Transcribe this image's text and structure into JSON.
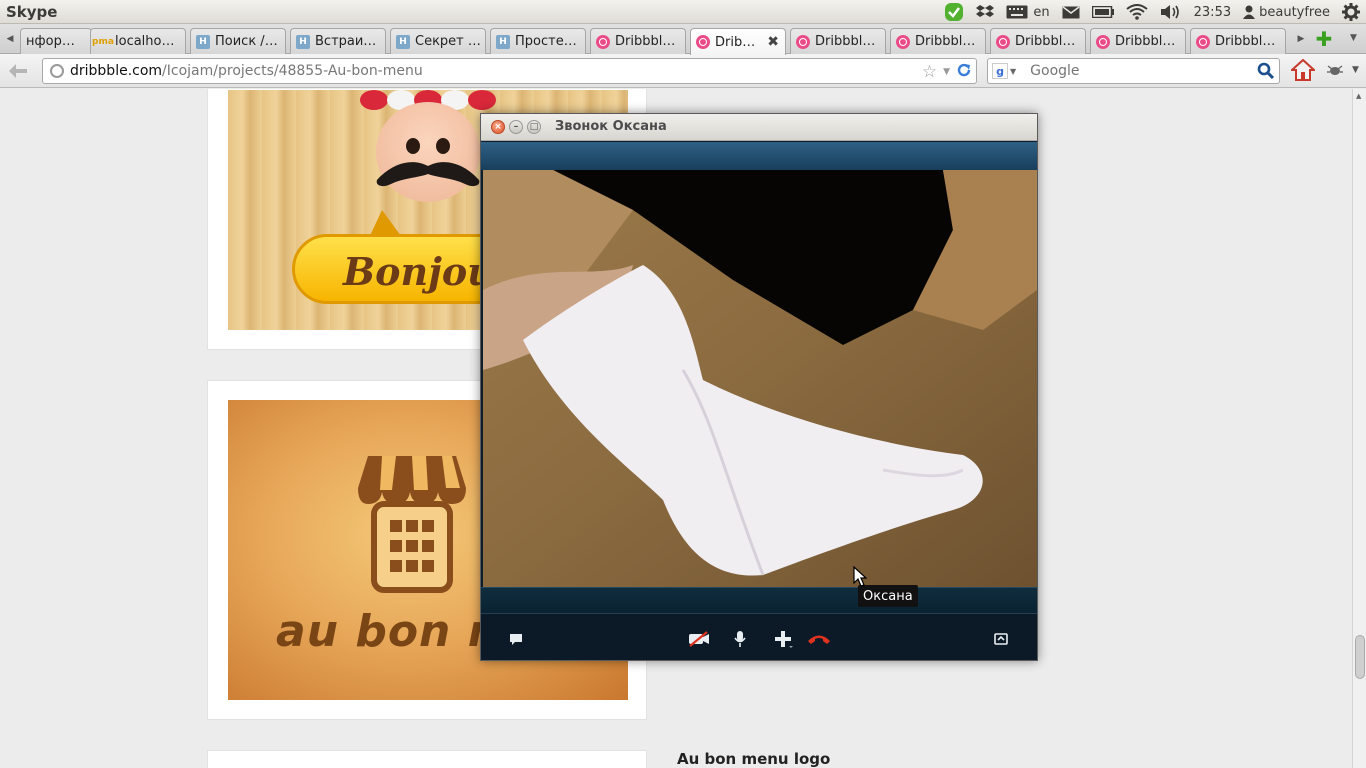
{
  "panel": {
    "app_name": "Skype",
    "keyboard_layout": "en",
    "time": "23:53",
    "user": "beautyfree"
  },
  "tabs": [
    {
      "label": "нфор…",
      "favicon": "none"
    },
    {
      "label": "localho…",
      "favicon": "phpmyadmin-icon"
    },
    {
      "label": "Поиск /…",
      "favicon": "habr-icon"
    },
    {
      "label": "Встраи…",
      "favicon": "habr-icon"
    },
    {
      "label": "Секрет …",
      "favicon": "habr-icon"
    },
    {
      "label": "Просте…",
      "favicon": "habr-icon"
    },
    {
      "label": "Dribbbl…",
      "favicon": "dribbble-icon"
    },
    {
      "label": "Drib…",
      "favicon": "dribbble-icon",
      "active": true
    },
    {
      "label": "Dribbbl…",
      "favicon": "dribbble-icon"
    },
    {
      "label": "Dribbbl…",
      "favicon": "dribbble-icon"
    },
    {
      "label": "Dribbbl…",
      "favicon": "dribbble-icon"
    },
    {
      "label": "Dribbbl…",
      "favicon": "dribbble-icon"
    },
    {
      "label": "Dribbbl…",
      "favicon": "dribbble-icon"
    }
  ],
  "toolbar": {
    "url_domain": "dribbble.com",
    "url_path": "/Icojam/projects/48855-Au-bon-menu",
    "search_placeholder": "Google"
  },
  "page": {
    "shot1_text": "Bonjour",
    "shot2_text": "au bon menu",
    "shot3_title": "Au bon menu logo"
  },
  "skype": {
    "window_title": "Звонок Оксана",
    "tooltip": "Оксана"
  },
  "colors": {
    "dribbble_pink": "#ea4c89",
    "skype_band": "#1d4a6b",
    "hangup_red": "#e0321f"
  }
}
